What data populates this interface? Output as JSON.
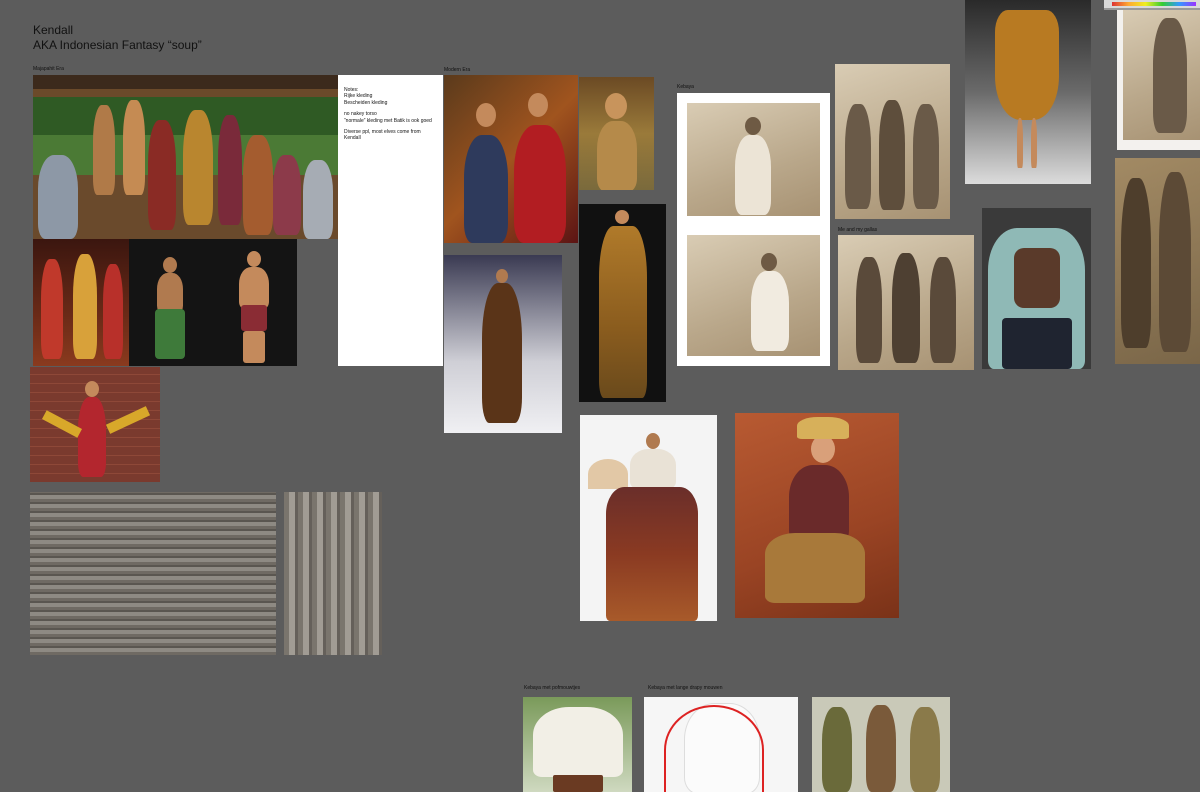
{
  "board": {
    "title_line1": "Kendall",
    "title_line2": "AKA Indonesian Fantasy “soup”"
  },
  "sections": {
    "majapahit": "Majapahit Era",
    "modern": "Modern Era",
    "kebaya": "Kebaya",
    "me_and_gals": "Me and my gallas",
    "kebaya_pofmouw": "Kebaya met pofmouwtjes",
    "kebaya_drapey": "Kebaya met lange drapy mouwen"
  },
  "notes": {
    "heading": "Notes:\nRijke kleding\nBescheiden kleding",
    "line2": "no nakey torso\n“normale” kleding met Batik is ook goed",
    "line3": "Diverse ppl, most elves come from\nKendall"
  },
  "colors": {
    "canvas": "#5c5c5c",
    "notes_bg": "#ffffff"
  }
}
